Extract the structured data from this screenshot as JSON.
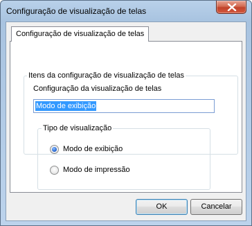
{
  "window": {
    "title": "Configuração de visualização de telas"
  },
  "tabs": [
    {
      "label": "Configuração de visualização de telas",
      "selected": true
    }
  ],
  "settings_group": {
    "title": "Itens da configuração de visualização de telas",
    "field_label": "Configuração da visualização de telas",
    "field_value": "Modo de exibição"
  },
  "view_type_group": {
    "title": "Tipo de visualização",
    "options": [
      {
        "label": "Modo de exibição",
        "checked": true
      },
      {
        "label": "Modo de impressão",
        "checked": false
      }
    ]
  },
  "buttons": {
    "ok": "OK",
    "cancel": "Cancelar"
  },
  "colors": {
    "accent": "#3399ff",
    "close_button": "#c0422a"
  },
  "icons": {
    "close": "close-icon"
  }
}
